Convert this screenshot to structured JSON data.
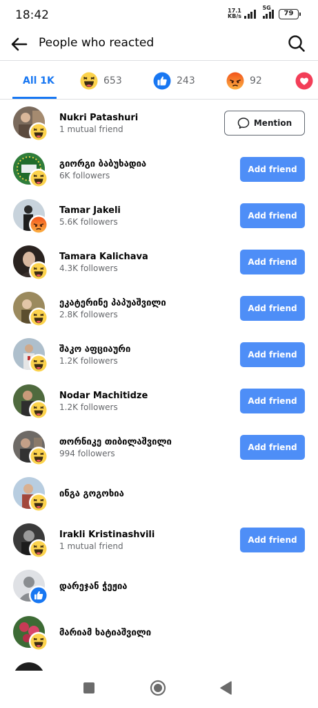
{
  "status_bar": {
    "time": "18:42",
    "net_speed_value": "17.1",
    "net_speed_unit": "KB/s",
    "network_label": "5G",
    "battery": "79"
  },
  "header": {
    "title": "People who reacted",
    "back_icon": "arrow-left-icon",
    "search_icon": "search-icon"
  },
  "tabs": [
    {
      "label": "All 1K",
      "icon": null,
      "active": true
    },
    {
      "label": "653",
      "icon": "haha-reaction-icon",
      "active": false
    },
    {
      "label": "243",
      "icon": "like-reaction-icon",
      "active": false
    },
    {
      "label": "92",
      "icon": "angry-reaction-icon",
      "active": false
    },
    {
      "label": "",
      "icon": "love-reaction-icon",
      "active": false
    }
  ],
  "colors": {
    "accent": "#1877f2",
    "add_button": "#4e8ef7",
    "haha_yellow": "#fcd34d",
    "angry_orange": "#f2541b",
    "love_red": "#f33e58"
  },
  "people": [
    {
      "name": "Nukri Patashuri",
      "subtitle": "1 mutual friend",
      "reaction": "haha",
      "action": "Mention"
    },
    {
      "name": "გიორგი ბაბუხადია",
      "subtitle": "6K followers",
      "reaction": "haha",
      "action": "Add friend"
    },
    {
      "name": "Tamar Jakeli",
      "subtitle": "5.6K followers",
      "reaction": "angry",
      "action": "Add friend"
    },
    {
      "name": "Tamara Kalichava",
      "subtitle": "4.3K followers",
      "reaction": "haha",
      "action": "Add friend"
    },
    {
      "name": "ეკატერინე პაპუაშვილი",
      "subtitle": "2.8K followers",
      "reaction": "haha",
      "action": "Add friend"
    },
    {
      "name": "შაკო აფციაური",
      "subtitle": "1.2K followers",
      "reaction": "haha",
      "action": "Add friend"
    },
    {
      "name": "Nodar Machitidze",
      "subtitle": "1.2K followers",
      "reaction": "haha",
      "action": "Add friend"
    },
    {
      "name": "თორნიკე თიბილაშვილი",
      "subtitle": "994 followers",
      "reaction": "haha",
      "action": "Add friend"
    },
    {
      "name": "ინგა გოგოხია",
      "subtitle": "",
      "reaction": "haha",
      "action": ""
    },
    {
      "name": "Irakli Kristinashvili",
      "subtitle": "1 mutual friend",
      "reaction": "haha",
      "action": "Add friend"
    },
    {
      "name": "დარეჯან ჭეჟია",
      "subtitle": "",
      "reaction": "like",
      "action": ""
    },
    {
      "name": "მარიამ ხატიაშვილი",
      "subtitle": "",
      "reaction": "haha",
      "action": ""
    }
  ],
  "nav_bar": {
    "recents_icon": "square-icon",
    "home_icon": "circle-icon",
    "back_icon": "triangle-back-icon"
  }
}
